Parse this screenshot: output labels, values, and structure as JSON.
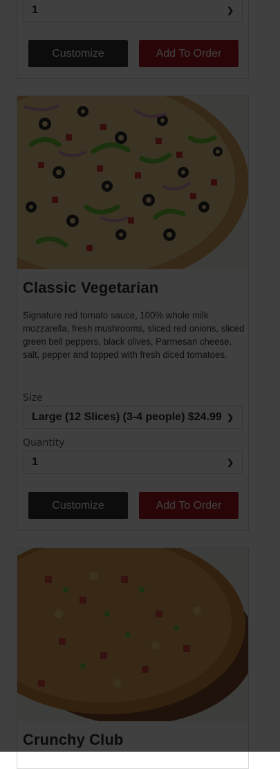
{
  "top_card": {
    "quantity_value": "1",
    "customize_label": "Customize",
    "add_label": "Add To Order"
  },
  "veg_card": {
    "title": "Classic Vegetarian",
    "description": "Signature red tomato sauce, 100% whole milk mozzarella, fresh mushrooms, sliced red onions, sliced green bell peppers, black olives, Parmesan cheese, salt, pepper and topped with fresh diced tomatoes.",
    "size_label": "Size",
    "size_value": "Large (12 Slices) (3-4 people) $24.99",
    "quantity_label": "Quantity",
    "quantity_value": "1",
    "customize_label": "Customize",
    "add_label": "Add To Order"
  },
  "club_card": {
    "title": "Crunchy Club"
  },
  "icons": {
    "select_arrow": "chevron-down-icon"
  },
  "colors": {
    "add_button": "#a8141c",
    "customize_button": "#333333",
    "overlay": "rgba(0,0,0,0.75)"
  }
}
